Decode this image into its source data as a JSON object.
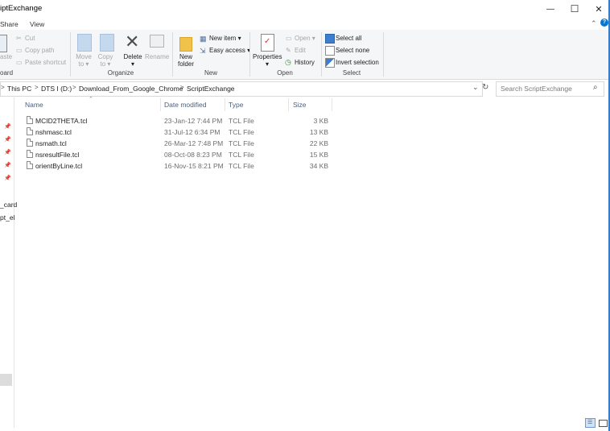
{
  "window": {
    "title": "iptExchange",
    "minimize_glyph": "—",
    "maximize_glyph": "☐",
    "close_glyph": "✕"
  },
  "ribbon_tabs": [
    "Share",
    "View"
  ],
  "ribbon": {
    "clipboard": {
      "cut": "Cut",
      "copy_path": "Copy path",
      "paste_shortcut": "Paste shortcut",
      "paste_partial": "aste",
      "group_label": "oard"
    },
    "organize": {
      "move_to_line1": "Move",
      "move_to_line2": "to ▾",
      "copy_to_line1": "Copy",
      "copy_to_line2": "to ▾",
      "delete_line1": "Delete",
      "delete_line2": "▾",
      "rename": "Rename",
      "group_label": "Organize"
    },
    "new": {
      "new_folder_line1": "New",
      "new_folder_line2": "folder",
      "new_item": "New item ▾",
      "easy_access": "Easy access ▾",
      "group_label": "New"
    },
    "open": {
      "properties_line1": "Properties",
      "properties_line2": "▾",
      "open": "Open ▾",
      "edit": "Edit",
      "history": "History",
      "group_label": "Open"
    },
    "select": {
      "select_all": "Select all",
      "select_none": "Select none",
      "invert_selection": "Invert selection",
      "group_label": "Select"
    }
  },
  "address": {
    "crumbs": [
      "This PC",
      "DTS I (D:)",
      "Download_From_Google_Chrome",
      "ScriptExchange"
    ],
    "separator": ">",
    "search_placeholder": "Search ScriptExchange"
  },
  "nav_pane": {
    "items": [
      "_card",
      "pt_el"
    ]
  },
  "columns": {
    "name": "Name",
    "date": "Date modified",
    "type": "Type",
    "size": "Size"
  },
  "files": [
    {
      "name": "MCID2THETA.tcl",
      "date": "23-Jan-12 7:44 PM",
      "type": "TCL File",
      "size": "3 KB"
    },
    {
      "name": "nshmasc.tcl",
      "date": "31-Jul-12 6:34 PM",
      "type": "TCL File",
      "size": "13 KB"
    },
    {
      "name": "nsmath.tcl",
      "date": "26-Mar-12 7:48 PM",
      "type": "TCL File",
      "size": "22 KB"
    },
    {
      "name": "nsresultFile.tcl",
      "date": "08-Oct-08 8:23 PM",
      "type": "TCL File",
      "size": "15 KB"
    },
    {
      "name": "orientByLine.tcl",
      "date": "16-Nov-15 8:21 PM",
      "type": "TCL File",
      "size": "34 KB"
    }
  ],
  "colors": {
    "accent": "#0078d7",
    "header_text": "#4c607a"
  }
}
